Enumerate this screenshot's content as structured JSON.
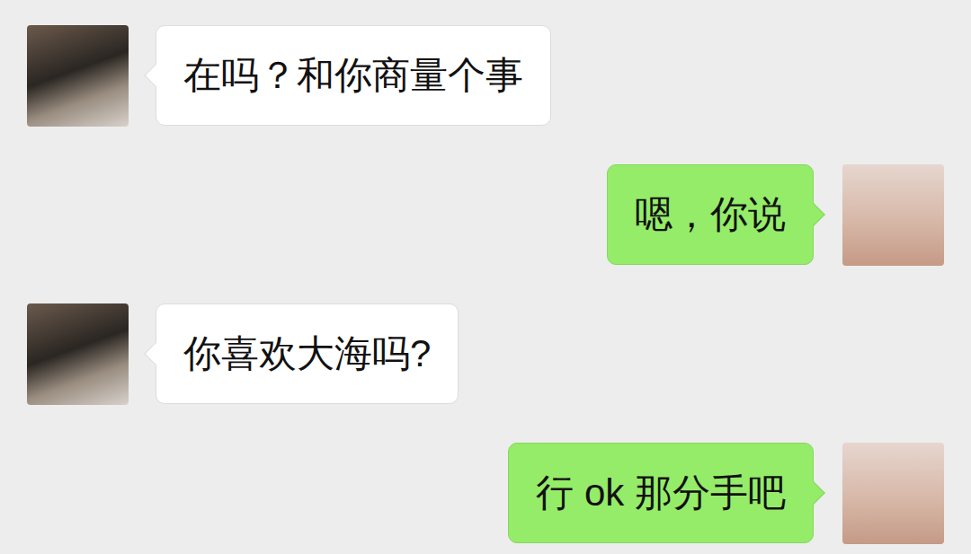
{
  "messages": [
    {
      "kind": "received",
      "text": "在吗？和你商量个事"
    },
    {
      "kind": "sent",
      "text": "嗯，你说"
    },
    {
      "kind": "received",
      "text": "你喜欢大海吗?"
    },
    {
      "kind": "sent",
      "text": "行 ok 那分手吧"
    }
  ]
}
